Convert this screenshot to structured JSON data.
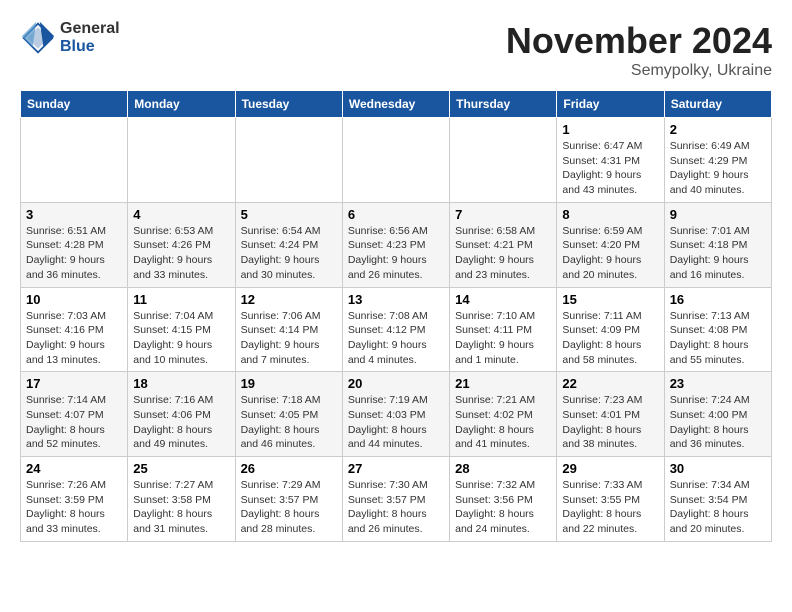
{
  "logo": {
    "general": "General",
    "blue": "Blue"
  },
  "header": {
    "month": "November 2024",
    "location": "Semypolky, Ukraine"
  },
  "weekdays": [
    "Sunday",
    "Monday",
    "Tuesday",
    "Wednesday",
    "Thursday",
    "Friday",
    "Saturday"
  ],
  "weeks": [
    [
      {
        "day": "",
        "info": ""
      },
      {
        "day": "",
        "info": ""
      },
      {
        "day": "",
        "info": ""
      },
      {
        "day": "",
        "info": ""
      },
      {
        "day": "",
        "info": ""
      },
      {
        "day": "1",
        "info": "Sunrise: 6:47 AM\nSunset: 4:31 PM\nDaylight: 9 hours\nand 43 minutes."
      },
      {
        "day": "2",
        "info": "Sunrise: 6:49 AM\nSunset: 4:29 PM\nDaylight: 9 hours\nand 40 minutes."
      }
    ],
    [
      {
        "day": "3",
        "info": "Sunrise: 6:51 AM\nSunset: 4:28 PM\nDaylight: 9 hours\nand 36 minutes."
      },
      {
        "day": "4",
        "info": "Sunrise: 6:53 AM\nSunset: 4:26 PM\nDaylight: 9 hours\nand 33 minutes."
      },
      {
        "day": "5",
        "info": "Sunrise: 6:54 AM\nSunset: 4:24 PM\nDaylight: 9 hours\nand 30 minutes."
      },
      {
        "day": "6",
        "info": "Sunrise: 6:56 AM\nSunset: 4:23 PM\nDaylight: 9 hours\nand 26 minutes."
      },
      {
        "day": "7",
        "info": "Sunrise: 6:58 AM\nSunset: 4:21 PM\nDaylight: 9 hours\nand 23 minutes."
      },
      {
        "day": "8",
        "info": "Sunrise: 6:59 AM\nSunset: 4:20 PM\nDaylight: 9 hours\nand 20 minutes."
      },
      {
        "day": "9",
        "info": "Sunrise: 7:01 AM\nSunset: 4:18 PM\nDaylight: 9 hours\nand 16 minutes."
      }
    ],
    [
      {
        "day": "10",
        "info": "Sunrise: 7:03 AM\nSunset: 4:16 PM\nDaylight: 9 hours\nand 13 minutes."
      },
      {
        "day": "11",
        "info": "Sunrise: 7:04 AM\nSunset: 4:15 PM\nDaylight: 9 hours\nand 10 minutes."
      },
      {
        "day": "12",
        "info": "Sunrise: 7:06 AM\nSunset: 4:14 PM\nDaylight: 9 hours\nand 7 minutes."
      },
      {
        "day": "13",
        "info": "Sunrise: 7:08 AM\nSunset: 4:12 PM\nDaylight: 9 hours\nand 4 minutes."
      },
      {
        "day": "14",
        "info": "Sunrise: 7:10 AM\nSunset: 4:11 PM\nDaylight: 9 hours\nand 1 minute."
      },
      {
        "day": "15",
        "info": "Sunrise: 7:11 AM\nSunset: 4:09 PM\nDaylight: 8 hours\nand 58 minutes."
      },
      {
        "day": "16",
        "info": "Sunrise: 7:13 AM\nSunset: 4:08 PM\nDaylight: 8 hours\nand 55 minutes."
      }
    ],
    [
      {
        "day": "17",
        "info": "Sunrise: 7:14 AM\nSunset: 4:07 PM\nDaylight: 8 hours\nand 52 minutes."
      },
      {
        "day": "18",
        "info": "Sunrise: 7:16 AM\nSunset: 4:06 PM\nDaylight: 8 hours\nand 49 minutes."
      },
      {
        "day": "19",
        "info": "Sunrise: 7:18 AM\nSunset: 4:05 PM\nDaylight: 8 hours\nand 46 minutes."
      },
      {
        "day": "20",
        "info": "Sunrise: 7:19 AM\nSunset: 4:03 PM\nDaylight: 8 hours\nand 44 minutes."
      },
      {
        "day": "21",
        "info": "Sunrise: 7:21 AM\nSunset: 4:02 PM\nDaylight: 8 hours\nand 41 minutes."
      },
      {
        "day": "22",
        "info": "Sunrise: 7:23 AM\nSunset: 4:01 PM\nDaylight: 8 hours\nand 38 minutes."
      },
      {
        "day": "23",
        "info": "Sunrise: 7:24 AM\nSunset: 4:00 PM\nDaylight: 8 hours\nand 36 minutes."
      }
    ],
    [
      {
        "day": "24",
        "info": "Sunrise: 7:26 AM\nSunset: 3:59 PM\nDaylight: 8 hours\nand 33 minutes."
      },
      {
        "day": "25",
        "info": "Sunrise: 7:27 AM\nSunset: 3:58 PM\nDaylight: 8 hours\nand 31 minutes."
      },
      {
        "day": "26",
        "info": "Sunrise: 7:29 AM\nSunset: 3:57 PM\nDaylight: 8 hours\nand 28 minutes."
      },
      {
        "day": "27",
        "info": "Sunrise: 7:30 AM\nSunset: 3:57 PM\nDaylight: 8 hours\nand 26 minutes."
      },
      {
        "day": "28",
        "info": "Sunrise: 7:32 AM\nSunset: 3:56 PM\nDaylight: 8 hours\nand 24 minutes."
      },
      {
        "day": "29",
        "info": "Sunrise: 7:33 AM\nSunset: 3:55 PM\nDaylight: 8 hours\nand 22 minutes."
      },
      {
        "day": "30",
        "info": "Sunrise: 7:34 AM\nSunset: 3:54 PM\nDaylight: 8 hours\nand 20 minutes."
      }
    ]
  ]
}
